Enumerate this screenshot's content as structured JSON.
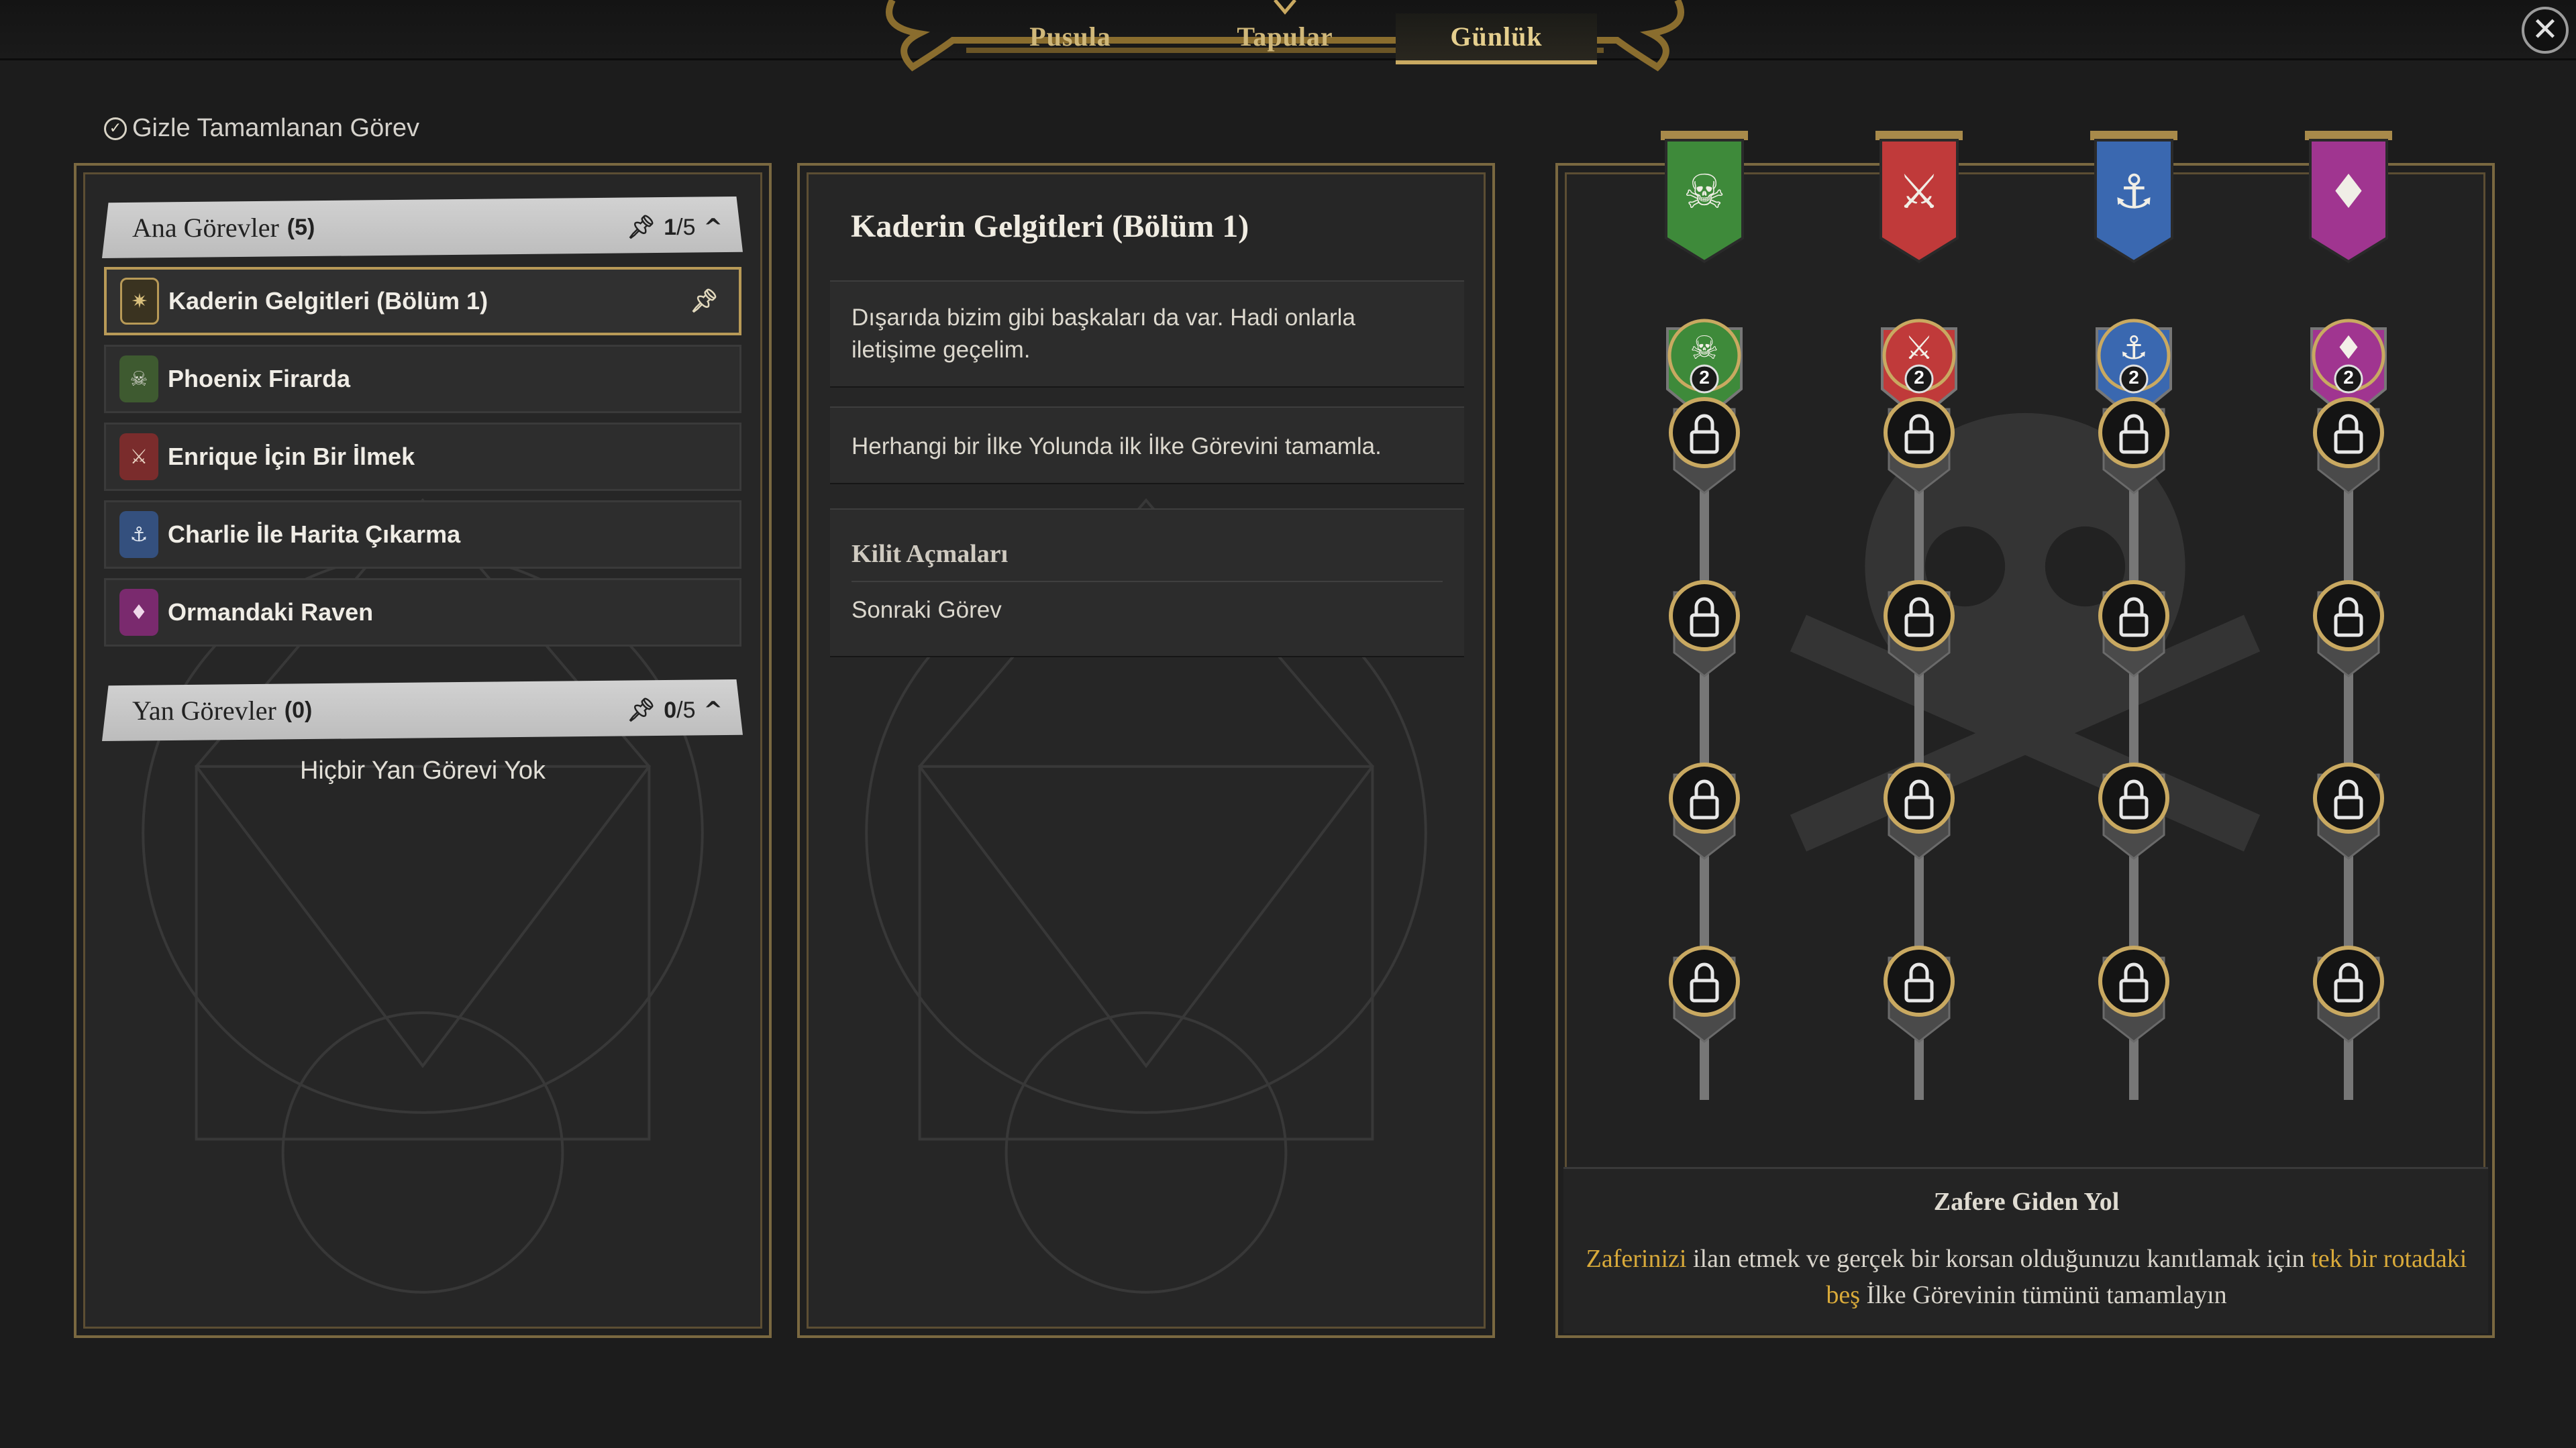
{
  "tabs": [
    {
      "label": "Pusula",
      "active": false
    },
    {
      "label": "Tapular",
      "active": false
    },
    {
      "label": "Günlük",
      "active": true
    }
  ],
  "close_icon": "close-icon",
  "hide_completed": {
    "label": "Gizle Tamamlanan Görev",
    "icon": "check-circle-icon"
  },
  "main_quests": {
    "title": "Ana Görevler",
    "count": "(5)",
    "pinned": "1",
    "total": "/5",
    "items": [
      {
        "label": "Kaderin Gelgitleri (Bölüm 1)",
        "icon": "compass-emblem-icon",
        "selected": true,
        "pinned": true
      },
      {
        "label": "Phoenix Firarda",
        "icon": "skull-emblem-icon",
        "selected": false
      },
      {
        "label": "Enrique İçin Bir İlmek",
        "icon": "crossed-swords-emblem-icon",
        "selected": false
      },
      {
        "label": "Charlie İle Harita Çıkarma",
        "icon": "anchor-emblem-icon",
        "selected": false
      },
      {
        "label": "Ormandaki Raven",
        "icon": "gem-emblem-icon",
        "selected": false
      }
    ]
  },
  "side_quests": {
    "title": "Yan Görevler",
    "count": "(0)",
    "pinned": "0",
    "total": "/5",
    "empty_text": "Hiçbir Yan Görevi Yok"
  },
  "detail": {
    "title": "Kaderin Gelgitleri (Bölüm 1)",
    "description": "Dışarıda bizim gibi başkaları da var. Hadi onlarla iletişime geçelim.",
    "objective": "Herhangi bir İlke Yolunda ilk İlke Görevini tamamla.",
    "unlocks_title": "Kilit Açmaları",
    "unlocks_item": "Sonraki Görev"
  },
  "paths": [
    {
      "banner_icon": "skull-flag-icon",
      "color": "#3e8a3a",
      "progress": "2"
    },
    {
      "banner_icon": "crossed-swords-flag-icon",
      "color": "#c03a3a",
      "progress": "2"
    },
    {
      "banner_icon": "anchor-flag-icon",
      "color": "#3a68b0",
      "progress": "2"
    },
    {
      "banner_icon": "gem-flag-icon",
      "color": "#a03590",
      "progress": "2"
    }
  ],
  "path_info": {
    "title": "Zafere Giden Yol",
    "desc_1": "Zaferinizi",
    "desc_2": " ilan etmek ve gerçek bir korsan olduğunuzu kanıtlamak için ",
    "desc_3": "tek bir rotadaki beş",
    "desc_4": " İlke Görevinin tümünü tamamlayın"
  },
  "colors": {
    "accent": "#c9a961",
    "highlight": "#d9aa3a",
    "panel": "#262626"
  }
}
